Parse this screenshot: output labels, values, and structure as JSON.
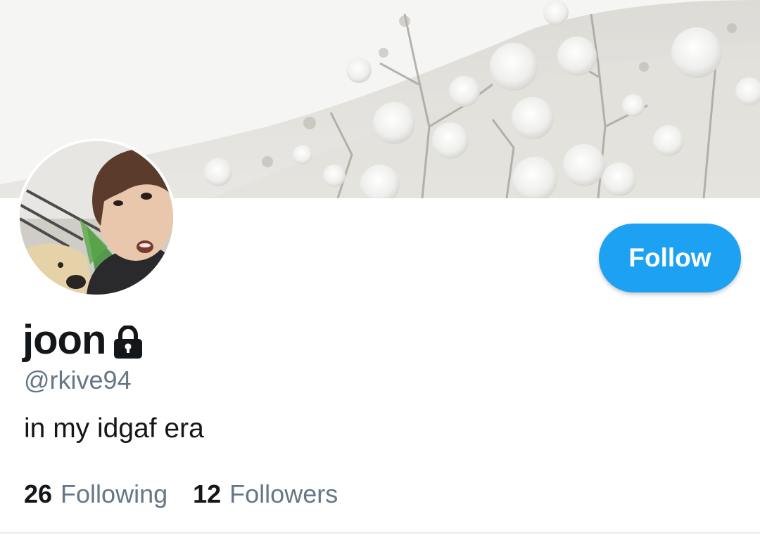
{
  "profile": {
    "display_name": "joon",
    "handle": "@rkive94",
    "bio": "in my idgaf era",
    "locked_icon": "lock-icon",
    "banner_description_icon": "banner-image",
    "avatar_icon": "avatar-image"
  },
  "actions": {
    "follow_label": "Follow"
  },
  "stats": {
    "following_count": "26",
    "following_label": "Following",
    "followers_count": "12",
    "followers_label": "Followers"
  },
  "colors": {
    "accent": "#1da1f2",
    "secondary_text": "#657786",
    "primary_text": "#14171a"
  }
}
